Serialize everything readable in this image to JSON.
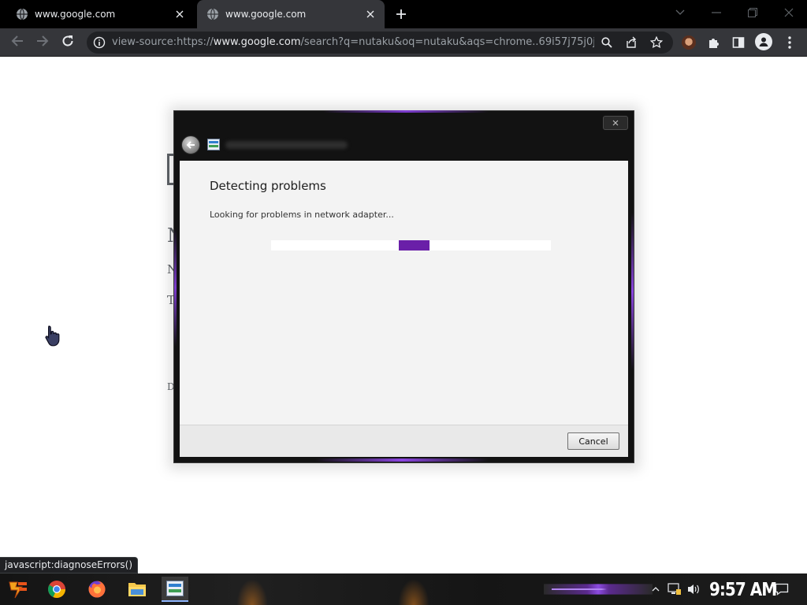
{
  "browser": {
    "tabs": [
      {
        "title": "www.google.com",
        "active": false
      },
      {
        "title": "www.google.com",
        "active": true
      }
    ],
    "url": {
      "scheme": "view-source:https://",
      "host": "www.google.com",
      "path": "/search?q=nutaku&oq=nutaku&aqs=chrome..69i57j75j0j..."
    },
    "status_bubble": "javascript:diagnoseErrors()"
  },
  "dialog": {
    "heading": "Detecting problems",
    "status": "Looking for problems in network adapter...",
    "progress_fraction": 0.51,
    "cancel_label": "Cancel",
    "accent_color": "#6a1fa8"
  },
  "page_behind": {
    "glyphs": [
      "N",
      "N",
      "T",
      "D"
    ]
  },
  "taskbar": {
    "apps": [
      "start-icon",
      "chrome-icon",
      "firefox-icon",
      "file-explorer-icon",
      "network-diagnostics-icon"
    ],
    "clock": "9:57 AM"
  },
  "icons": [
    "globe-icon",
    "close-icon",
    "plus-icon",
    "chevron-down-icon",
    "minimize-icon",
    "restore-icon",
    "back-arrow-icon",
    "forward-arrow-icon",
    "reload-icon",
    "info-icon",
    "search-icon",
    "share-icon",
    "star-icon",
    "extensions-puzzle-icon",
    "side-panel-icon",
    "profile-icon",
    "menu-dots-icon",
    "hand-cursor-icon",
    "speaker-icon",
    "network-icon",
    "notification-icon"
  ]
}
